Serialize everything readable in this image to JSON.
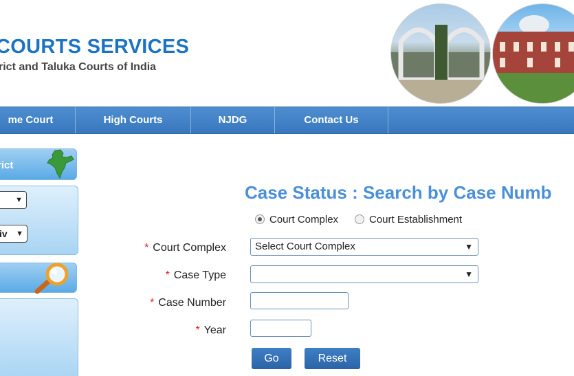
{
  "header": {
    "title": "COURTS SERVICES",
    "subtitle": "rict and Taluka Courts of India"
  },
  "nav": {
    "items": [
      {
        "label": "me Court"
      },
      {
        "label": "High Courts"
      },
      {
        "label": "NJDG"
      },
      {
        "label": "Contact Us"
      }
    ]
  },
  "sidebar": {
    "tab_label": "rict",
    "select_1_value": "",
    "select_2_value": "iv",
    "india_icon": "india-map-icon",
    "search_icon": "magnifier-icon"
  },
  "form": {
    "title": "Case Status : Search by Case Numb",
    "radio_options": [
      {
        "label": "Court Complex",
        "checked": true
      },
      {
        "label": "Court Establishment",
        "checked": false
      }
    ],
    "required_mark": "*",
    "fields": [
      {
        "label": "Court Complex",
        "value": "Select Court Complex"
      },
      {
        "label": "Case Type",
        "value": ""
      },
      {
        "label": "Case Number",
        "value": ""
      },
      {
        "label": "Year",
        "value": ""
      }
    ],
    "arrow": "▼",
    "go_label": "Go",
    "reset_label": "Reset"
  },
  "colors": {
    "brand_blue": "#1a73c4",
    "nav_blue": "#3877bd",
    "title_blue": "#4a90d9",
    "required_red": "#d22222"
  }
}
